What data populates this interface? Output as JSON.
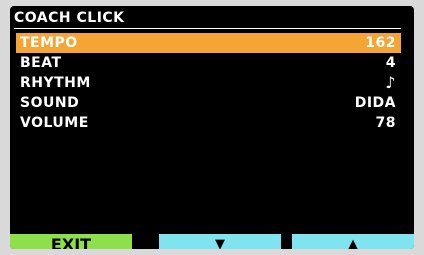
{
  "screen": {
    "title": "COACH CLICK"
  },
  "menu": {
    "items": [
      {
        "label": "TEMPO",
        "value": "162",
        "selected": true
      },
      {
        "label": "BEAT",
        "value": "4"
      },
      {
        "label": "RHYTHM",
        "value": "♪"
      },
      {
        "label": "SOUND",
        "value": "DIDA"
      },
      {
        "label": "VOLUME",
        "value": "78"
      }
    ]
  },
  "buttons": {
    "exit_label": "EXIT",
    "down_icon": "down-arrow",
    "up_icon": "up-arrow",
    "down_glyph": "▼",
    "up_glyph": "▲"
  },
  "colors": {
    "selection": "#f5a534",
    "exit_button": "#8ee04a",
    "arrow_buttons": "#7fe3f0"
  }
}
